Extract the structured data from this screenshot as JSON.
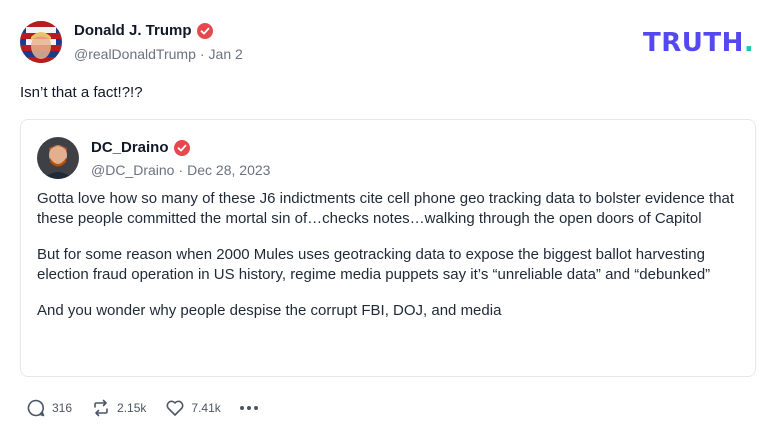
{
  "post": {
    "author_name": "Donald J. Trump",
    "author_handle": "@realDonaldTrump",
    "separator": "·",
    "date": "Jan 2",
    "text": "Isn’t that a fact!?!?"
  },
  "logo": {
    "text": "TRUTH",
    "dot": ".",
    "colors": {
      "primary": "#5448ee",
      "accent": "#16c9b0"
    }
  },
  "quote": {
    "author_name": "DC_Draino",
    "author_handle": "@DC_Draino",
    "separator": "·",
    "date": "Dec 28, 2023",
    "paragraphs": [
      "Gotta love how so many of these J6 indictments cite cell phone geo tracking data to bolster evidence that these people committed the mortal sin of…checks notes…walking through the open doors of Capitol",
      "But for some reason when 2000 Mules uses geotracking data to expose the biggest ballot harvesting election fraud operation in US history, regime media puppets say it’s “unreliable data” and “debunked”",
      "And you wonder why people despise the corrupt FBI, DOJ, and media"
    ]
  },
  "actions": {
    "replies": "316",
    "retruths": "2.15k",
    "likes": "7.41k",
    "icons": {
      "reply": "comment-icon",
      "retruth": "retruth-icon",
      "like": "heart-icon",
      "more": "more-icon"
    }
  },
  "colors": {
    "verified": "#e5484d",
    "text": "#111827",
    "muted": "#6b7280"
  }
}
